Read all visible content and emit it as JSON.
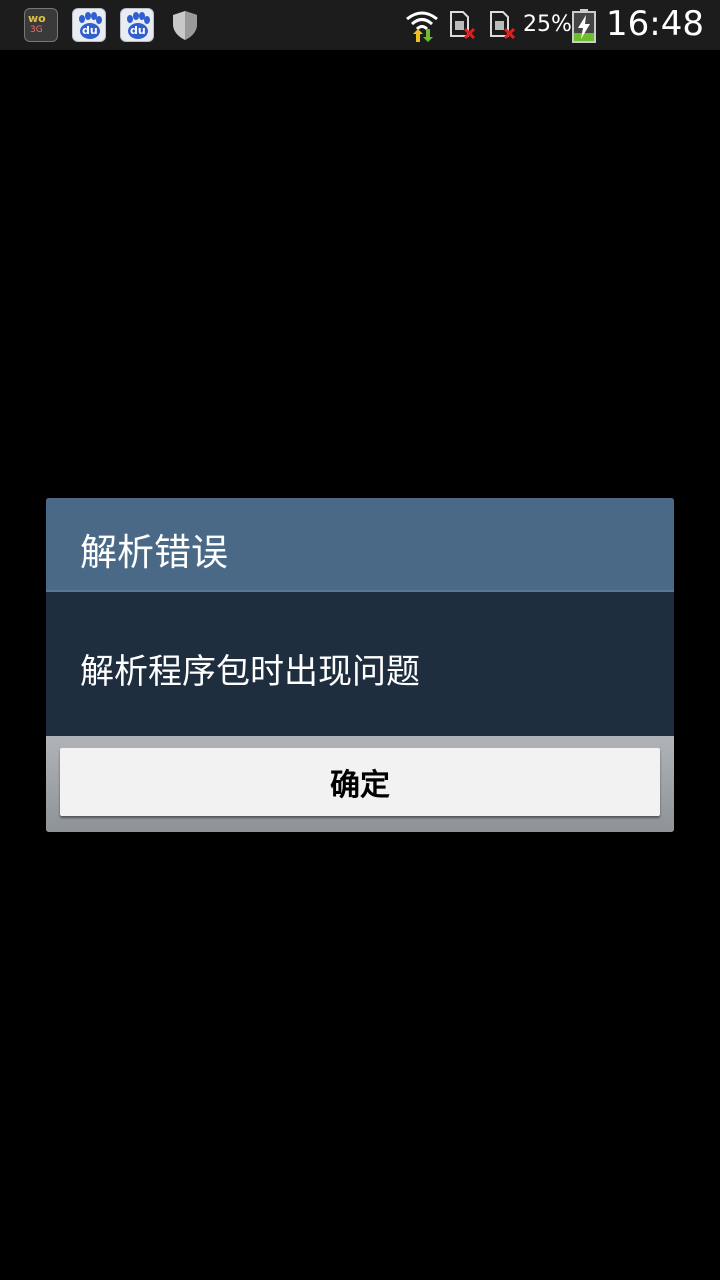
{
  "status_bar": {
    "notification_icons": [
      "wo-app-icon",
      "baidu-icon",
      "baidu-icon",
      "shield-icon"
    ],
    "wo_icon_text_top": "wo",
    "wo_icon_text_bottom": "3G",
    "baidu_label": "du",
    "system_icons": [
      "wifi-icon",
      "sim1-no-signal-icon",
      "sim2-no-signal-icon",
      "battery-charging-icon"
    ],
    "battery_percent": "25%",
    "battery_level": 0.25,
    "time": "16:48",
    "colors": {
      "background": "#1c1c1c",
      "wifi_arrows": "#f0c020",
      "sim_x": "#e02020",
      "battery_fill": "#6cbf2a"
    }
  },
  "dialog": {
    "title": "解析错误",
    "message": "解析程序包时出现问题",
    "ok_button_label": "确定",
    "colors": {
      "title_bg": "#4a6987",
      "body_bg": "#1e2e3e",
      "button_bg": "#f2f2f2"
    }
  }
}
